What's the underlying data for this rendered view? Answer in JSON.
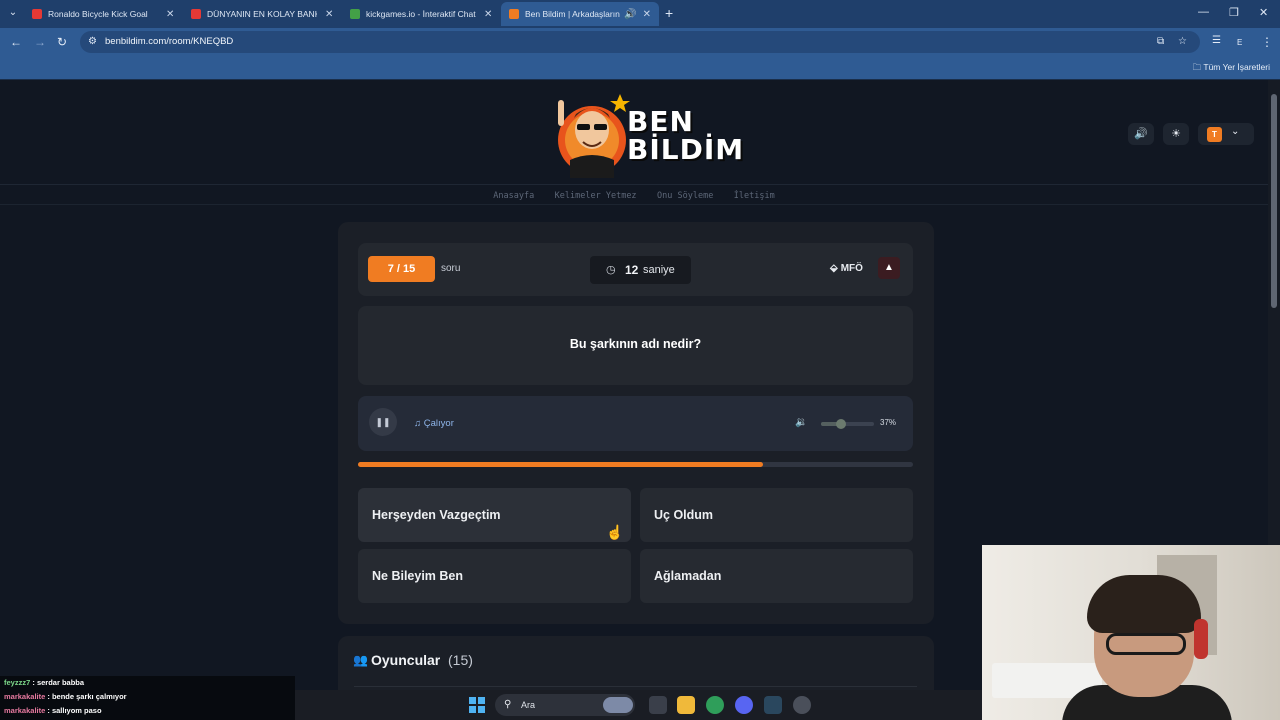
{
  "browser": {
    "tabs": [
      {
        "title": "Ronaldo Bicycle Kick Goal",
        "favicon_color": "#e53935",
        "active": false
      },
      {
        "title": "DÜNYANIN EN KOLAY BANKA",
        "favicon_color": "#e53935",
        "active": false
      },
      {
        "title": "kickgames.io - İnteraktif Chat O",
        "favicon_color": "#43a047",
        "active": false
      },
      {
        "title": "Ben Bildim | Arkadaşlarınla",
        "favicon_color": "#f07c22",
        "active": true
      }
    ],
    "url": "benbildim.com/room/KNEQBD",
    "bookmarks_all": "Tüm Yer İşaretleri"
  },
  "site": {
    "logo_line1": "BEN",
    "logo_line2": "BİLDİM",
    "user_initial": "T",
    "nav": [
      "Anasayfa",
      "Kelimeler Yetmez",
      "Onu Söyleme",
      "İletişim"
    ]
  },
  "game": {
    "counter": "7 / 15",
    "counter_suffix": "soru",
    "timer_value": "12",
    "timer_unit": "saniye",
    "category": "MFÖ",
    "question": "Bu şarkının adı nedir?",
    "player_status": "Çalıyor",
    "volume_percent_label": "37%",
    "volume_fraction": 0.37,
    "progress_fraction": 0.73,
    "answers": [
      "Herşeyden Vazgeçtim",
      "Uç Oldum",
      "Ne Bileyim Ben",
      "Ağlamadan"
    ]
  },
  "players": {
    "title": "Oyuncular",
    "count": "(15)"
  },
  "chat": [
    {
      "user": "feyzzz7",
      "message": ": serdar babba"
    },
    {
      "user": "markakalite",
      "message": ": bende şarkı çalmıyor"
    },
    {
      "user": "markakalite",
      "message": ": sallıyom paso"
    }
  ],
  "taskbar": {
    "search_placeholder": "Ara"
  },
  "colors": {
    "accent": "#f07c22",
    "background": "#111722",
    "card": "#1b1f27"
  }
}
